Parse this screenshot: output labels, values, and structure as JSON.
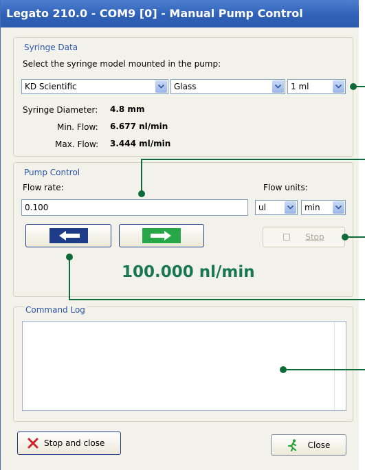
{
  "window": {
    "title": "Legato 210.0 - COM9 [0] - Manual Pump Control"
  },
  "syringe": {
    "group_title": "Syringe Data",
    "instruction": "Select the syringe model mounted in the pump:",
    "manufacturer": "KD Scientific",
    "material": "Glass",
    "volume": "1 ml",
    "diameter_label": "Syringe Diameter:",
    "diameter_value": "4.8 mm",
    "min_flow_label": "Min. Flow:",
    "min_flow_value": "6.677 nl/min",
    "max_flow_label": "Max. Flow:",
    "max_flow_value": "3.444 ml/min"
  },
  "pump": {
    "group_title": "Pump Control",
    "flow_rate_label": "Flow rate:",
    "flow_rate_value": "0.100",
    "flow_units_label": "Flow units:",
    "unit_volume": "ul",
    "unit_time": "min",
    "stop_label": "Stop",
    "current_rate": "100.000 nl/min"
  },
  "log": {
    "group_title": "Command Log"
  },
  "footer": {
    "stop_close_label": "Stop and close",
    "close_label": "Close"
  },
  "colors": {
    "title_bar": "#2f61b8",
    "rate_text": "#18774d",
    "annotation": "#0d6b3a",
    "infuse_arrow": "#27a748",
    "withdraw_button": "#1f3c88"
  }
}
